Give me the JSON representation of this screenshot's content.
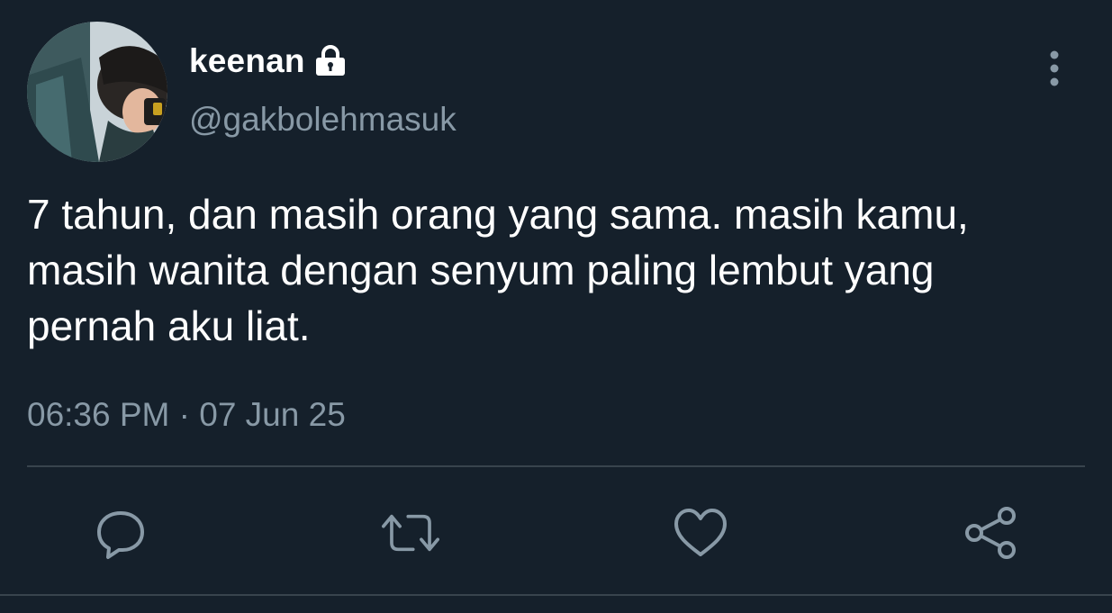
{
  "user": {
    "display_name": "keenan",
    "handle": "@gakbolehmasuk",
    "avatar_icon": "profile-photo",
    "protected_icon": "lock-icon"
  },
  "tweet": {
    "text": "7 tahun, dan masih orang yang sama. masih kamu, masih wanita dengan senyum paling lembut yang pernah aku liat.",
    "timestamp": "06:36 PM · 07 Jun 25"
  },
  "actions": {
    "reply_icon": "reply-icon",
    "retweet_icon": "retweet-icon",
    "like_icon": "heart-icon",
    "share_icon": "share-icon",
    "more_icon": "more-vertical-icon"
  },
  "colors": {
    "background": "#15202b",
    "primary_text": "#ffffff",
    "secondary_text": "#8899a6",
    "divider": "#38444d",
    "icon": "#8899a6"
  }
}
